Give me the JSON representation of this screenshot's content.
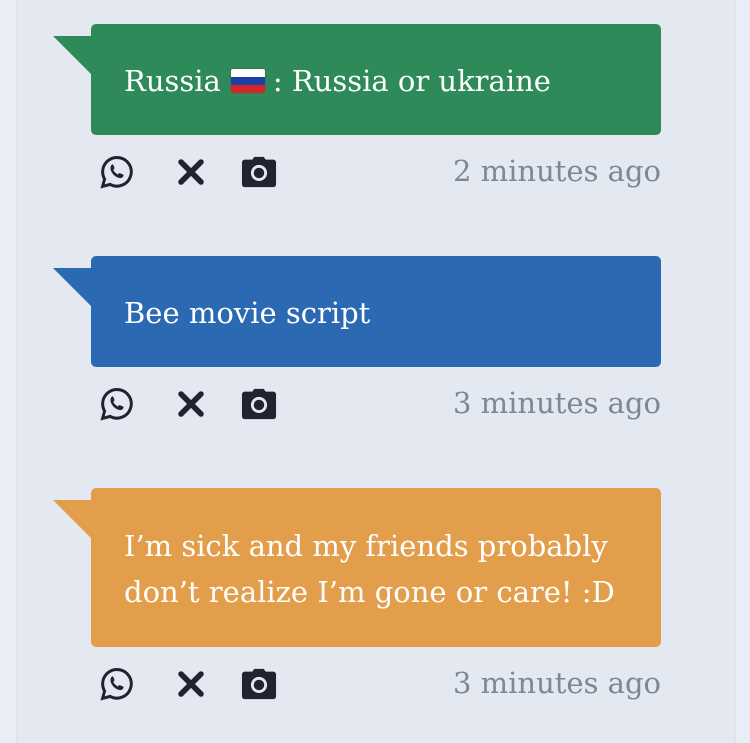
{
  "posts": [
    {
      "message_before_flag": "Russia",
      "flag": "russia-flag-icon",
      "message_after_flag": ": Russia or ukraine",
      "color": "#2e8a58",
      "time": "2 minutes ago"
    },
    {
      "message": "Bee movie script",
      "color": "#2b6ab3",
      "time": "3 minutes ago"
    },
    {
      "message_line1": "I’m sick and my friends probably",
      "message_line2": "don’t realize I’m gone or care! :D",
      "color": "#e39e4b",
      "time": "3 minutes ago"
    }
  ],
  "icons": {
    "share": "whatsapp-icon",
    "dismiss": "close-icon",
    "screenshot": "camera-icon"
  }
}
